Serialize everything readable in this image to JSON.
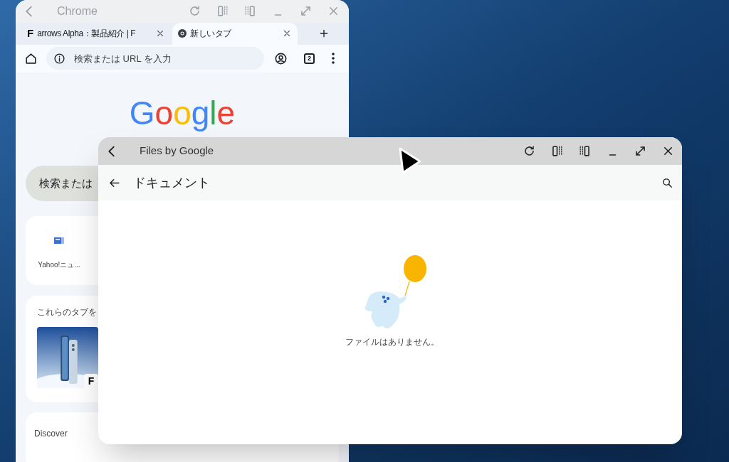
{
  "chrome_window": {
    "title": "Chrome",
    "tabs": [
      {
        "favicon": "F",
        "label": "arrows Alpha：製品紹介 | F",
        "selected": false
      },
      {
        "label": "新しいタブ",
        "selected": true
      }
    ],
    "omnibox": {
      "placeholder": "検索または URL を入力"
    },
    "tab_count": "2",
    "new_tab_page": {
      "logo": "Google",
      "search": {
        "placeholder": "検索または"
      },
      "shortcuts": [
        {
          "label": "Yahoo!ニュ..."
        }
      ],
      "resume_card": {
        "title": "これらのタブを",
        "badge": "F"
      },
      "discover": "Discover"
    }
  },
  "files_window": {
    "title": "Files by Google",
    "header": "ドキュメント",
    "empty_message": "ファイルはありません。"
  }
}
